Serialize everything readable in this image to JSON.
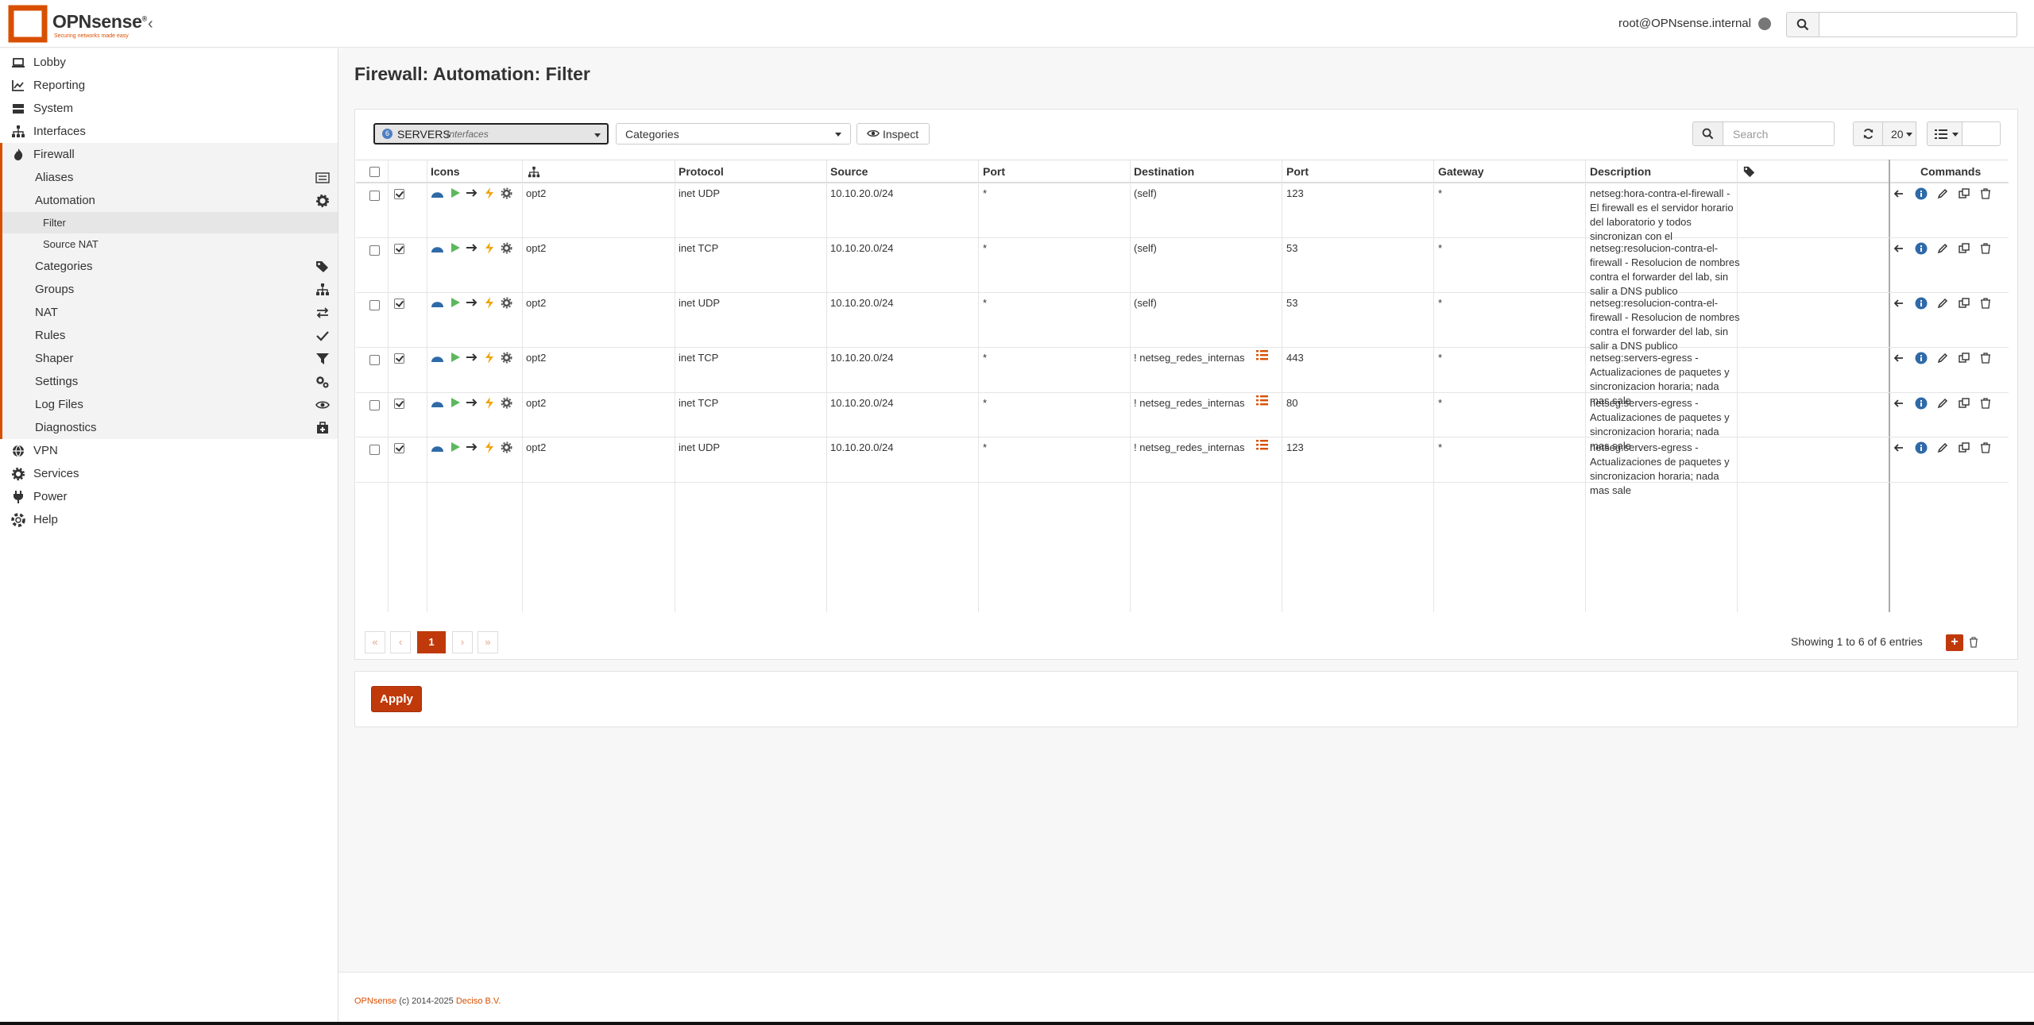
{
  "header": {
    "logo_text": "OPNsense",
    "logo_sup": "®",
    "logo_tagline": "Securing networks made easy",
    "user": "root@OPNsense.internal",
    "search_placeholder": ""
  },
  "sidebar": {
    "items": [
      {
        "label": "Lobby",
        "icon": "laptop-icon"
      },
      {
        "label": "Reporting",
        "icon": "chart-icon"
      },
      {
        "label": "System",
        "icon": "server-icon"
      },
      {
        "label": "Interfaces",
        "icon": "sitemap-icon"
      },
      {
        "label": "Firewall",
        "icon": "fire-icon"
      },
      {
        "label": "VPN",
        "icon": "globe-icon"
      },
      {
        "label": "Services",
        "icon": "cog-icon"
      },
      {
        "label": "Power",
        "icon": "plug-icon"
      },
      {
        "label": "Help",
        "icon": "support-icon"
      }
    ],
    "firewall_sub": [
      {
        "label": "Aliases",
        "icon": "list-icon"
      },
      {
        "label": "Automation",
        "icon": "gear-icon"
      },
      {
        "label": "Categories",
        "icon": "tags-icon"
      },
      {
        "label": "Groups",
        "icon": "sitemap-icon"
      },
      {
        "label": "NAT",
        "icon": "exchange-icon"
      },
      {
        "label": "Rules",
        "icon": "check-icon"
      },
      {
        "label": "Shaper",
        "icon": "filter-icon"
      },
      {
        "label": "Settings",
        "icon": "cogs-icon"
      },
      {
        "label": "Log Files",
        "icon": "eye-icon"
      },
      {
        "label": "Diagnostics",
        "icon": "medkit-icon"
      }
    ],
    "automation_sub": [
      {
        "label": "Filter"
      },
      {
        "label": "Source NAT"
      }
    ]
  },
  "page": {
    "title": "Firewall: Automation: Filter"
  },
  "toolbar": {
    "interface_value": "SERVERS",
    "interface_sub": "Interfaces",
    "interface_badge": "6",
    "categories_placeholder": "Categories",
    "inspect_label": "Inspect",
    "search_placeholder": "Search",
    "page_size": "20"
  },
  "table": {
    "columns": [
      "Icons",
      "Protocol",
      "Source",
      "Port",
      "Destination",
      "Port",
      "Gateway",
      "Description",
      "Commands"
    ],
    "rows": [
      {
        "enabled": true,
        "interface": "opt2",
        "protocol": "inet UDP",
        "source": "10.10.20.0/24",
        "src_port": "*",
        "destination": "(self)",
        "dst_alias": false,
        "dst_port": "123",
        "gateway": "*",
        "description": "netseg:hora-contra-el-firewall - El firewall es el servidor horario del laboratorio y todos sincronizan con el"
      },
      {
        "enabled": true,
        "interface": "opt2",
        "protocol": "inet TCP",
        "source": "10.10.20.0/24",
        "src_port": "*",
        "destination": "(self)",
        "dst_alias": false,
        "dst_port": "53",
        "gateway": "*",
        "description": "netseg:resolucion-contra-el-firewall - Resolucion de nombres contra el forwarder del lab, sin salir a DNS publico"
      },
      {
        "enabled": true,
        "interface": "opt2",
        "protocol": "inet UDP",
        "source": "10.10.20.0/24",
        "src_port": "*",
        "destination": "(self)",
        "dst_alias": false,
        "dst_port": "53",
        "gateway": "*",
        "description": "netseg:resolucion-contra-el-firewall - Resolucion de nombres contra el forwarder del lab, sin salir a DNS publico"
      },
      {
        "enabled": true,
        "interface": "opt2",
        "protocol": "inet TCP",
        "source": "10.10.20.0/24",
        "src_port": "*",
        "destination": "! netseg_redes_internas",
        "dst_alias": true,
        "dst_port": "443",
        "gateway": "*",
        "description": "netseg:servers-egress - Actualizaciones de paquetes y sincronizacion horaria; nada mas sale"
      },
      {
        "enabled": true,
        "interface": "opt2",
        "protocol": "inet TCP",
        "source": "10.10.20.0/24",
        "src_port": "*",
        "destination": "! netseg_redes_internas",
        "dst_alias": true,
        "dst_port": "80",
        "gateway": "*",
        "description": "netseg:servers-egress - Actualizaciones de paquetes y sincronizacion horaria; nada mas sale"
      },
      {
        "enabled": true,
        "interface": "opt2",
        "protocol": "inet UDP",
        "source": "10.10.20.0/24",
        "src_port": "*",
        "destination": "! netseg_redes_internas",
        "dst_alias": true,
        "dst_port": "123",
        "gateway": "*",
        "description": "netseg:servers-egress - Actualizaciones de paquetes y sincronizacion horaria; nada mas sale"
      }
    ]
  },
  "pagination": {
    "first": "«",
    "prev": "‹",
    "current": "1",
    "next": "›",
    "last": "»",
    "showing": "Showing 1 to 6 of 6 entries"
  },
  "apply_label": "Apply",
  "footer": {
    "brand": "OPNsense",
    "copyright": "(c) 2014-2025",
    "company": "Deciso B.V."
  },
  "colors": {
    "accent": "#d94f00",
    "button": "#c0390b",
    "info": "#2f6aa8"
  }
}
